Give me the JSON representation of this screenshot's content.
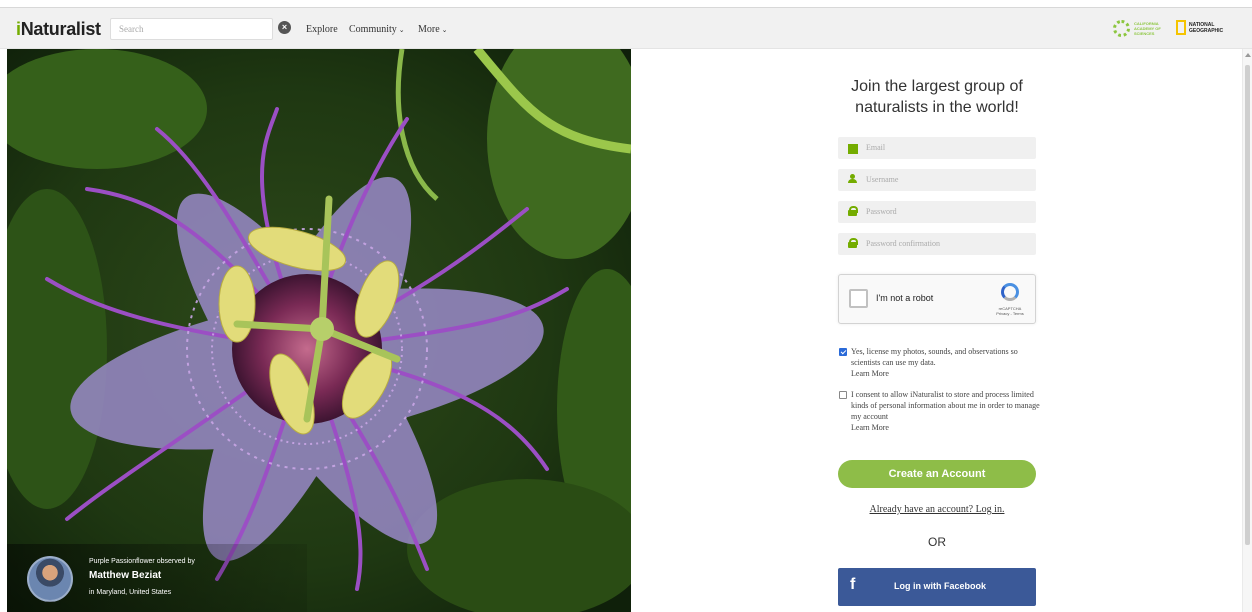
{
  "header": {
    "logo_prefix": "i",
    "logo_rest": "Naturalist",
    "search_placeholder": "Search",
    "nav": [
      {
        "label": "Explore",
        "has_dropdown": false
      },
      {
        "label": "Community",
        "has_dropdown": true
      },
      {
        "label": "More",
        "has_dropdown": true
      }
    ],
    "partner_cas_text": "CALIFORNIA ACADEMY OF SCIENCES",
    "partner_ng_text": "NATIONAL GEOGRAPHIC"
  },
  "hero": {
    "caption_line1": "Purple Passionflower observed by",
    "observer": "Matthew Beziat",
    "location": "in Maryland, United States"
  },
  "signup": {
    "heading": "Join the largest group of naturalists in the world!",
    "email_placeholder": "Email",
    "username_placeholder": "Username",
    "password_placeholder": "Password",
    "password_confirm_placeholder": "Password confirmation",
    "captcha_label": "I'm not a robot",
    "captcha_brand": "reCAPTCHA",
    "captcha_links": "Privacy - Terms",
    "license_text": "Yes, license my photos, sounds, and observations so scientists can use my data.",
    "license_checked": true,
    "consent_text": "I consent to allow iNaturalist to store and process limited kinds of personal information about me in order to manage my account",
    "consent_checked": false,
    "learn_more": "Learn More",
    "create_button": "Create an Account",
    "login_link": "Already have an account? Log in.",
    "or_text": "OR",
    "facebook_icon": "f",
    "facebook_button": "Log in with Facebook"
  },
  "colors": {
    "brand_green": "#74ac00",
    "create_button": "#8ebd48",
    "facebook_blue": "#3b5998"
  }
}
